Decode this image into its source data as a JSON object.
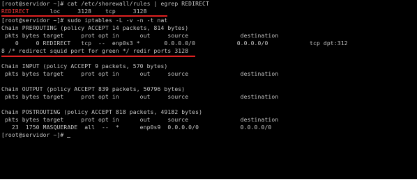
{
  "terminal": {
    "lines": [
      {
        "text": "[root@servidor ~]# cat /etc/shorewall/rules | egrep REDIRECT"
      },
      {
        "highlight": "REDIRECT",
        "text": "      loc     3128    tcp     3128"
      },
      {
        "text": "[root@servidor ~]# sudo iptables -L -v -n -t nat"
      },
      {
        "text": "Chain PREROUTING (policy ACCEPT 14 packets, 814 bytes)"
      },
      {
        "text": " pkts bytes target     prot opt in      out     source               destination"
      },
      {
        "text": "    0     0 REDIRECT   tcp  --  enp0s3 *       0.0.0.0/0            0.0.0.0/0            tcp dpt:312"
      },
      {
        "text": "8 /* redirect squid port for green */ redir ports 3128"
      },
      {
        "text": ""
      },
      {
        "text": "Chain INPUT (policy ACCEPT 9 packets, 570 bytes)"
      },
      {
        "text": " pkts bytes target     prot opt in      out     source               destination"
      },
      {
        "text": ""
      },
      {
        "text": "Chain OUTPUT (policy ACCEPT 839 packets, 50796 bytes)"
      },
      {
        "text": " pkts bytes target     prot opt in      out     source               destination"
      },
      {
        "text": ""
      },
      {
        "text": "Chain POSTROUTING (policy ACCEPT 818 packets, 49182 bytes)"
      },
      {
        "text": " pkts bytes target     prot opt in      out     source               destination"
      },
      {
        "text": "   23  1750 MASQUERADE  all  --  *      enp0s9  0.0.0.0/0            0.0.0.0/0"
      },
      {
        "text": "[root@servidor ~]# "
      }
    ]
  },
  "colors": {
    "background": "#000000",
    "foreground": "#c8c8c8",
    "highlight": "#ff3b3b",
    "underline": "#e02020"
  }
}
